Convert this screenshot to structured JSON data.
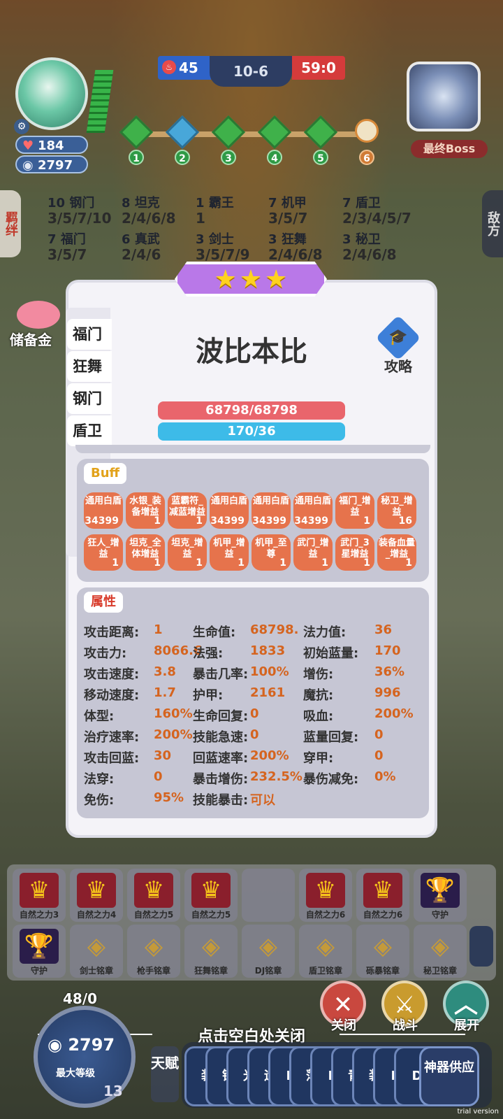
{
  "hud": {
    "score_left": "45",
    "stage": "10-6",
    "score_right": "59:0",
    "hp": "184",
    "coins": "2797",
    "boss_label": "最终Boss",
    "stages": [
      "1",
      "2",
      "3",
      "4",
      "5",
      "6"
    ]
  },
  "side_tabs": {
    "left": "羁绊",
    "right": "敌方"
  },
  "bonds": [
    {
      "count": "10",
      "name": "钢门",
      "levels": "3/5/7/10"
    },
    {
      "count": "8",
      "name": "坦克",
      "levels": "2/4/6/8"
    },
    {
      "count": "1",
      "name": "霸王",
      "levels": "1"
    },
    {
      "count": "7",
      "name": "机甲",
      "levels": "3/5/7"
    },
    {
      "count": "7",
      "name": "盾卫",
      "levels": "2/3/4/5/7"
    },
    {
      "count": "7",
      "name": "福门",
      "levels": "3/5/7"
    },
    {
      "count": "6",
      "name": "真武",
      "levels": "2/4/6"
    },
    {
      "count": "3",
      "name": "剑士",
      "levels": "3/5/7/9"
    },
    {
      "count": "3",
      "name": "狂舞",
      "levels": "2/4/6/8"
    },
    {
      "count": "3",
      "name": "秘卫",
      "levels": "2/4/6/8"
    }
  ],
  "piggy_label": "储备金",
  "modal": {
    "title": "波比本比",
    "guide_label": "攻略",
    "hp": "68798/68798",
    "mp": "170/36",
    "tabs": [
      "福门",
      "狂舞",
      "钢门",
      "盾卫"
    ],
    "buff_tag": "Buff",
    "attr_tag": "属性",
    "buffs": [
      {
        "name": "通用白盾",
        "value": "34399"
      },
      {
        "name": "水银_装备增益",
        "value": "1"
      },
      {
        "name": "蓝霸符_减蓝增益",
        "value": "1"
      },
      {
        "name": "通用白盾",
        "value": "34399"
      },
      {
        "name": "通用白盾",
        "value": "34399"
      },
      {
        "name": "通用白盾",
        "value": "34399"
      },
      {
        "name": "福门_增益",
        "value": "1"
      },
      {
        "name": "秘卫_增益",
        "value": "16"
      },
      {
        "name": "狂人_增益",
        "value": "1"
      },
      {
        "name": "坦克_全体增益",
        "value": "1"
      },
      {
        "name": "坦克_增益",
        "value": "1"
      },
      {
        "name": "机甲_增益",
        "value": "1"
      },
      {
        "name": "机甲_至尊",
        "value": "1"
      },
      {
        "name": "武门_增益",
        "value": "1"
      },
      {
        "name": "武门_3星增益",
        "value": "1"
      },
      {
        "name": "装备血量_增益",
        "value": "1"
      }
    ],
    "attributes": [
      [
        {
          "k": "攻击距离:",
          "v": "1"
        },
        {
          "k": "生命值:",
          "v": "68798."
        },
        {
          "k": "法力值:",
          "v": "36"
        }
      ],
      [
        {
          "k": "攻击力:",
          "v": "8066.6"
        },
        {
          "k": "法强:",
          "v": "1833"
        },
        {
          "k": "初始蓝量:",
          "v": "170"
        }
      ],
      [
        {
          "k": "攻击速度:",
          "v": "3.8"
        },
        {
          "k": "暴击几率:",
          "v": "100%"
        },
        {
          "k": "增伤:",
          "v": "36%"
        }
      ],
      [
        {
          "k": "移动速度:",
          "v": "1.7"
        },
        {
          "k": "护甲:",
          "v": "2161"
        },
        {
          "k": "魔抗:",
          "v": "996"
        }
      ],
      [
        {
          "k": "体型:",
          "v": "160%"
        },
        {
          "k": "生命回复:",
          "v": "0"
        },
        {
          "k": "吸血:",
          "v": "200%"
        }
      ],
      [
        {
          "k": "治疗速率:",
          "v": "200%"
        },
        {
          "k": "技能急速:",
          "v": "0"
        },
        {
          "k": "蓝量回复:",
          "v": "0"
        }
      ],
      [
        {
          "k": "攻击回蓝:",
          "v": "30"
        },
        {
          "k": "回蓝速率:",
          "v": "200%"
        },
        {
          "k": "穿甲:",
          "v": "0"
        }
      ],
      [
        {
          "k": "法穿:",
          "v": "0"
        },
        {
          "k": "暴击增伤:",
          "v": "232.5%"
        },
        {
          "k": "暴伤减免:",
          "v": "0%"
        }
      ],
      [
        {
          "k": "免伤:",
          "v": "95%"
        },
        {
          "k": "技能暴击:",
          "v": "可以"
        }
      ]
    ]
  },
  "slots_row1": [
    "自然之力3",
    "自然之力4",
    "自然之力5",
    "自然之力5",
    "",
    "自然之力6",
    "自然之力6",
    "守护"
  ],
  "slots_row2": [
    "守护",
    "剑士铭章",
    "枪手铭章",
    "狂舞铭章",
    "DJ铭章",
    "盾卫铭章",
    "砾暴铭章",
    "秘卫铭章"
  ],
  "buttons": {
    "close": "关闭",
    "fight": "战斗",
    "expand": "展开"
  },
  "close_hint": "点击空白处关闭",
  "bottom": {
    "level_ratio": "48/0",
    "coins": "2797",
    "max_level": "最大等级",
    "level": "13",
    "talent": "天赋",
    "cards": [
      "装",
      "铜",
      "光",
      "运",
      "D",
      "薄",
      "D",
      "青",
      "装",
      "D",
      "D"
    ],
    "artifact": "神器供应"
  },
  "watermark": "trial version"
}
